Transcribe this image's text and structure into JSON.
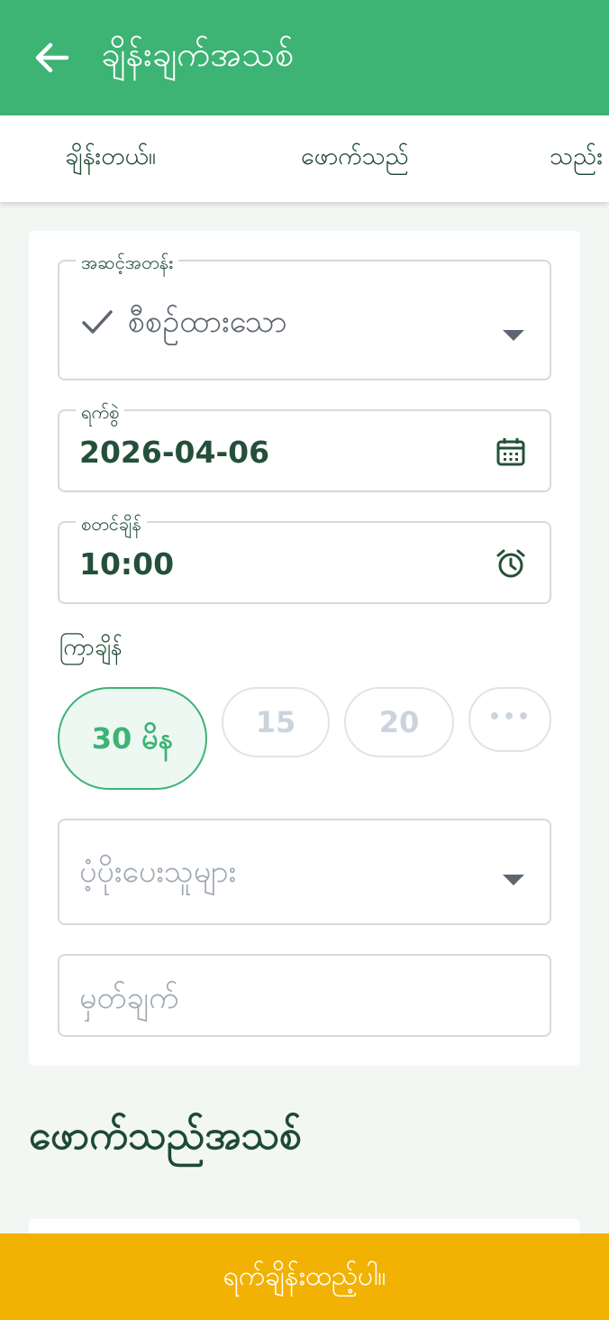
{
  "appbar": {
    "title": "ချိန်းချက်အသစ်",
    "back_icon": "arrow-left-icon"
  },
  "tabs": [
    {
      "label": "ချိန်းတယ်။"
    },
    {
      "label": "ဖောက်သည်"
    },
    {
      "label": "သည်း"
    }
  ],
  "form": {
    "status": {
      "label": "အဆင့်အတန်း",
      "value": "စီစဉ်ထားသော",
      "icon": "check-icon"
    },
    "date": {
      "label": "ရက်စွဲ",
      "value": "2026-04-06",
      "icon": "calendar-icon"
    },
    "start_time": {
      "label": "စတင်ချိန်",
      "value": "10:00",
      "icon": "alarm-clock-icon"
    },
    "duration": {
      "label": "ကြာချိန်",
      "options": [
        {
          "label": "30 မိန",
          "selected": true
        },
        {
          "label": "15",
          "selected": false
        },
        {
          "label": "20",
          "selected": false
        },
        {
          "label": "•••",
          "selected": false
        }
      ]
    },
    "providers": {
      "placeholder": "ပံ့ပိုးပေးသူများ"
    },
    "note": {
      "placeholder": "မှတ်ချက်"
    }
  },
  "new_customer_title": "ဖောက်သည်အသစ်",
  "footer": {
    "button_label": "ရက်ချိန်းထည့်ပါ။"
  },
  "colors": {
    "primary": "#3db374",
    "accent": "#f2b204",
    "text": "#1e4a33"
  }
}
